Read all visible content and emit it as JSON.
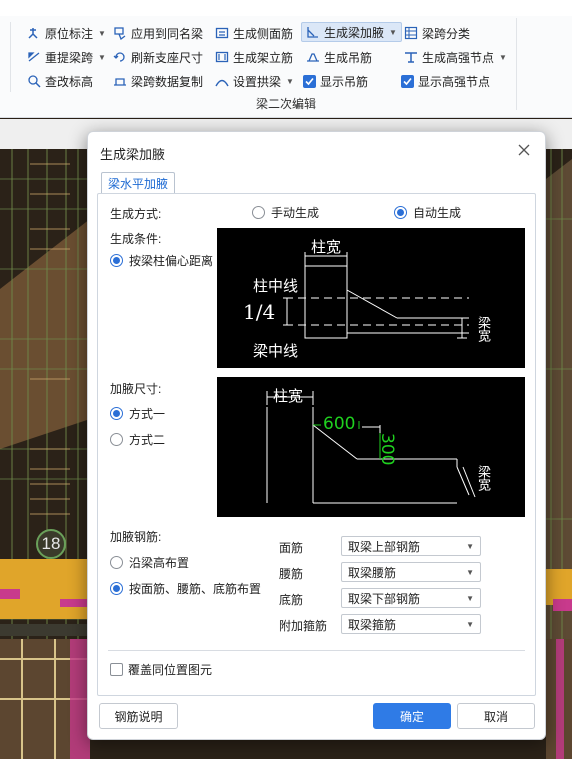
{
  "ribbon": {
    "row1": [
      "原位标注",
      "应用到同名梁",
      "生成侧面筋",
      "生成梁加腋",
      "梁跨分类"
    ],
    "row2": [
      "重提梁跨",
      "刷新支座尺寸",
      "生成架立筋",
      "生成吊筋",
      "生成高强节点"
    ],
    "row3": [
      "查改标高",
      "梁跨数据复制",
      "设置拱梁",
      "显示吊筋",
      "显示高强节点"
    ],
    "group_label": "梁二次编辑"
  },
  "canvas": {
    "circle_label": "18"
  },
  "dialog": {
    "title": "生成梁加腋",
    "tab": "梁水平加腋",
    "gen_method_label": "生成方式:",
    "manual_label": "手动生成",
    "auto_label": "自动生成",
    "condition_label": "生成条件:",
    "condition_option": "按梁柱偏心距离",
    "diagram1": {
      "col_width": "柱宽",
      "col_center": "柱中线",
      "quarter": "1/4",
      "beam_center": "梁中线",
      "beam_width": "梁宽"
    },
    "size_label": "加腋尺寸:",
    "mode1": "方式一",
    "mode2": "方式二",
    "diagram2": {
      "col_width": "柱宽",
      "dim_600": "600",
      "dim_300": "300",
      "beam_width": "梁宽"
    },
    "rebar_label": "加腋钢筋:",
    "along_height": "沿梁高布置",
    "by_bars": "按面筋、腰筋、底筋布置",
    "face_label": "面筋",
    "face_value": "取梁上部钢筋",
    "waist_label": "腰筋",
    "waist_value": "取梁腰筋",
    "bottom_label": "底筋",
    "bottom_value": "取梁下部钢筋",
    "stirrup_label": "附加箍筋",
    "stirrup_value": "取梁箍筋",
    "overwrite_label": "覆盖同位置图元",
    "help_button": "钢筋说明",
    "ok_button": "确定",
    "cancel_button": "取消"
  }
}
